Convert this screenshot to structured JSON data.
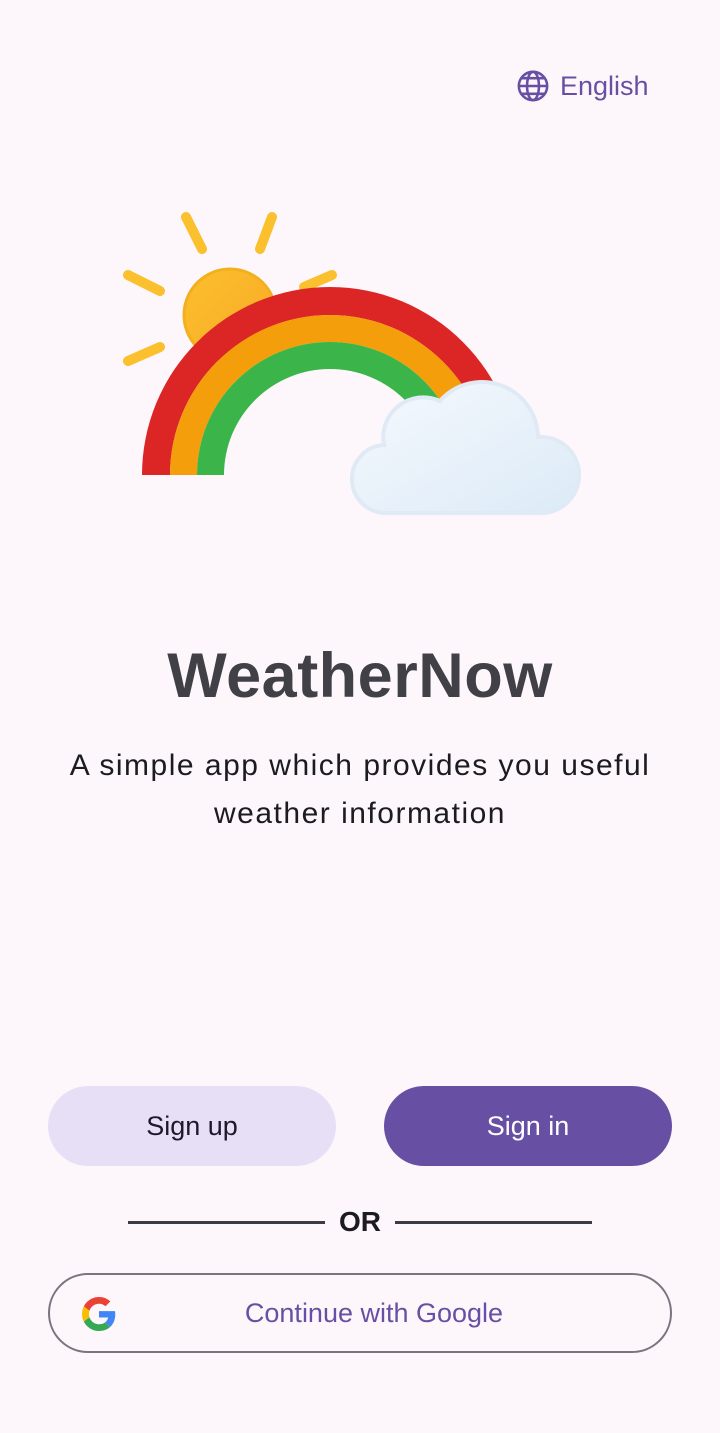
{
  "header": {
    "language_label": "English",
    "language_icon": "globe-icon"
  },
  "hero": {
    "illustration": "rainbow-sun-cloud-illustration"
  },
  "app": {
    "title": "WeatherNow",
    "tagline": "A simple app which provides you useful weather information"
  },
  "actions": {
    "signup_label": "Sign up",
    "signin_label": "Sign in",
    "or_label": "OR",
    "google_label": "Continue with Google",
    "google_icon": "google-icon"
  },
  "colors": {
    "background": "#fdf7fc",
    "primary": "#6750a4",
    "secondary_container": "#e7dff6",
    "title": "#414047"
  }
}
